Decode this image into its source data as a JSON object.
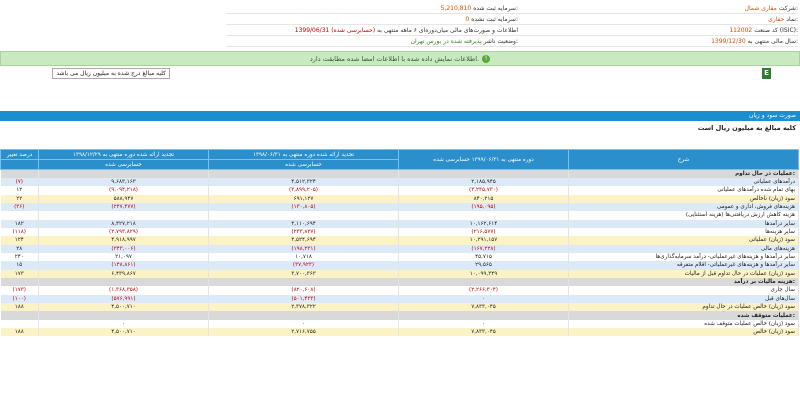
{
  "info": {
    "right": [
      {
        "label": "شرکت:",
        "value": "مقاری شمال"
      },
      {
        "label": "نماد:",
        "value": "حفاری"
      },
      {
        "label": "کد صنعت (ISIC):",
        "value": "112002"
      },
      {
        "label": "سال مالی منتهی به:",
        "value": "1399/12/30"
      }
    ],
    "left_top": [
      {
        "label": "سرمایه ثبت شده:",
        "value": "5,210,810"
      },
      {
        "label": "سرمایه ثبت نشده:",
        "value": "0"
      },
      {
        "label": "اطلاعات و صورت‌های مالی میان‌دوره‌ای ۶ ماهه منتهی به",
        "value": "1399/06/31 (حسابرسی شده)"
      },
      {
        "label": "وضعیت ناشر:",
        "value": "پذیرفته شده در بورس تهران"
      }
    ]
  },
  "notice": {
    "text": "اطلاعات نمایش داده شده با اطلاعات امضا شده مطابقت دارد.",
    "icon": "check-circle-icon"
  },
  "unit_select": {
    "value": "کلیه مبالغ درج شده به میلیون ریال می باشد",
    "excel_icon": "excel-export-icon",
    "excel_glyph": "E"
  },
  "section": {
    "title": "صورت سود و زیان",
    "subtitle": "کلیه مبالغ به میلیون ریال است"
  },
  "table": {
    "headers": {
      "desc": "شرح",
      "col1": "دوره منتهی به ۱۳۹۹/۰۶/۳۱ حسابرسی شده",
      "col2": "تجدید ارائه شده دوره منتهی به ۱۳۹۸/۰۶/۳۱",
      "col3": "تجدید ارائه شده دوره منتهی به ۱۳۹۸/۱۲/۲۹",
      "col4": "درصد تغییر",
      "col2_sub": "حسابرسی شده",
      "col3_sub": "حسابرسی شده"
    },
    "rows": [
      {
        "type": "section",
        "desc": "عملیات در حال تداوم:",
        "c1": "",
        "c2": "",
        "c3": "",
        "c4": ""
      },
      {
        "type": "blue",
        "desc": "درآمدهای عملیاتی",
        "c1": "۲,۱۸۵,۹۴۵",
        "c2": "۴,۵۱۲,۳۲۴",
        "c3": "۹,۶۸۳,۱۶۳",
        "c4": "(۷)",
        "neg1": false,
        "neg2": false,
        "neg3": false,
        "neg4": true
      },
      {
        "type": "plain",
        "desc": "بهای تمام شده درآمدهای عملیاتی",
        "c1": "(۳,۲۳۵,۷۳۰)",
        "c2": "(۳,۸۹۹,۲۰۵)",
        "c3": "(۹,۰۹۴,۲۱۸)",
        "c4": "۱۲",
        "neg1": true,
        "neg2": true,
        "neg3": true,
        "neg4": false
      },
      {
        "type": "yellow",
        "desc": "سود (زیان) ناخالص",
        "c1": "۸۴۰,۲۱۵",
        "c2": "۶۹۱,۱۲۷",
        "c3": "۵۸۸,۹۴۷",
        "c4": "۲۲",
        "neg1": false,
        "neg2": false,
        "neg3": false,
        "neg4": false
      },
      {
        "type": "blue",
        "desc": "هزینه‌های فروش، اداری و عمومی",
        "c1": "(۱۹۵,۰۹۵)",
        "c2": "(۱۳۰,۸۰۵)",
        "c3": "(۲۴۷,۴۷۷)",
        "c4": "(۳۶)",
        "neg1": true,
        "neg2": true,
        "neg3": true,
        "neg4": true
      },
      {
        "type": "plain",
        "desc": "هزینه کاهش ارزش دریافتنی‌ها (هزینه استثنایی)",
        "c1": "",
        "c2": "",
        "c3": "",
        "c4": ""
      },
      {
        "type": "blue",
        "desc": "سایر درآمدها",
        "c1": "۱۰,۱۶۲,۶۱۴",
        "c2": "۴,۱۱۰,۶۹۴",
        "c3": "۸,۴۲۷,۲۱۸",
        "c4": "۱۸۲",
        "neg1": false,
        "neg2": false,
        "neg3": false,
        "neg4": false
      },
      {
        "type": "plain",
        "desc": "سایر هزینه‌ها",
        "c1": "(۲۱۶,۵۷۷)",
        "c2": "(۲۳۳,۸۲۷)",
        "c3": "(۲,۷۹۳,۸۲۹)",
        "c4": "(۱۱۸)",
        "neg1": true,
        "neg2": true,
        "neg3": true,
        "neg4": true
      },
      {
        "type": "yellow",
        "desc": "سود (زیان) عملیاتی",
        "c1": "۱۰,۲۹۱,۱۵۷",
        "c2": "۴,۵۲۴,۶۹۴",
        "c3": "۴,۹۱۸,۹۹۷",
        "c4": "۱۲۴",
        "neg1": false,
        "neg2": false,
        "neg3": false,
        "neg4": false
      },
      {
        "type": "blue",
        "desc": "هزینه‌های مالی",
        "c1": "(۱۶۷,۲۲۸)",
        "c2": "(۱۹۸,۲۳۱)",
        "c3": "(۳۴۳,۰۰۶)",
        "c4": "۲۸",
        "neg1": true,
        "neg2": true,
        "neg3": true,
        "neg4": false
      },
      {
        "type": "plain",
        "desc": "سایر درآمدها و هزینه‌های غیرعملیاتی- درآمد سرمایه‌گذاری‌ها",
        "c1": "۴۵,۷۱۵",
        "c2": "۱۰,۷۱۸",
        "c3": "۲۱,۰۹۷",
        "c4": "۲۴۰",
        "neg1": false,
        "neg2": false,
        "neg3": false,
        "neg4": false
      },
      {
        "type": "blue",
        "desc": "سایر درآمدها و هزینه‌های غیرعملیاتی- اقلام متفرقه",
        "c1": "۲۹,۵۶۵",
        "c2": "(۳۷,۹۲۳)",
        "c3": "(۱۴۸,۸۶۱)",
        "c4": "۱۵",
        "neg1": false,
        "neg2": true,
        "neg3": true,
        "neg4": false
      },
      {
        "type": "yellow",
        "desc": "سود (زیان) عملیات در حال تداوم قبل از مالیات",
        "c1": "۱۰,۰۹۹,۳۴۹",
        "c2": "۳,۷۰۰,۳۶۳",
        "c3": "۶,۴۳۹,۸۶۷",
        "c4": "۱۷۳",
        "neg1": false,
        "neg2": false,
        "neg3": false,
        "neg4": false
      },
      {
        "type": "section",
        "desc": "هزینه مالیات بر درآمد:",
        "c1": "",
        "c2": "",
        "c3": "",
        "c4": ""
      },
      {
        "type": "plain",
        "desc": "سال جاری",
        "c1": "(۲,۲۶۶,۳۰۴)",
        "c2": "(۸۲۰,۶۰۸)",
        "c3": "(۱,۳۶۸,۳۵۸)",
        "c4": "(۱۷۳)",
        "neg1": true,
        "neg2": true,
        "neg3": true,
        "neg4": true
      },
      {
        "type": "blue",
        "desc": "سال‌های قبل",
        "c1": "۰",
        "c2": "(۵۰۱,۴۳۳)",
        "c3": "(۵۷۶,۹۹۱)",
        "c4": "(۱۰۰)",
        "neg1": false,
        "neg2": true,
        "neg3": true,
        "neg4": true
      },
      {
        "type": "yellow",
        "desc": "سود (زیان) خالص عملیات در حال تداوم",
        "c1": "۷,۸۳۳,۰۴۵",
        "c2": "۲,۳۷۸,۳۲۲",
        "c3": "۴,۵۰۰,۷۱۰",
        "c4": "۱۸۸",
        "neg1": false,
        "neg2": false,
        "neg3": false,
        "neg4": false
      },
      {
        "type": "section",
        "desc": "عملیات متوقف شده:",
        "c1": "",
        "c2": "",
        "c3": "",
        "c4": ""
      },
      {
        "type": "plain",
        "desc": "سود (زیان) خالص عملیات متوقف شده",
        "c1": "۰",
        "c2": "۰",
        "c3": "۰",
        "c4": "",
        "neg1": false,
        "neg2": false,
        "neg3": false,
        "neg4": false
      },
      {
        "type": "yellow",
        "desc": "سود (زیان) خالص",
        "c1": "۷,۸۳۳,۰۴۵",
        "c2": "۲,۷۱۶,۷۵۵",
        "c3": "۴,۵۰۰,۷۱۰",
        "c4": "۱۸۸",
        "neg1": false,
        "neg2": false,
        "neg3": false,
        "neg4": false
      }
    ]
  }
}
